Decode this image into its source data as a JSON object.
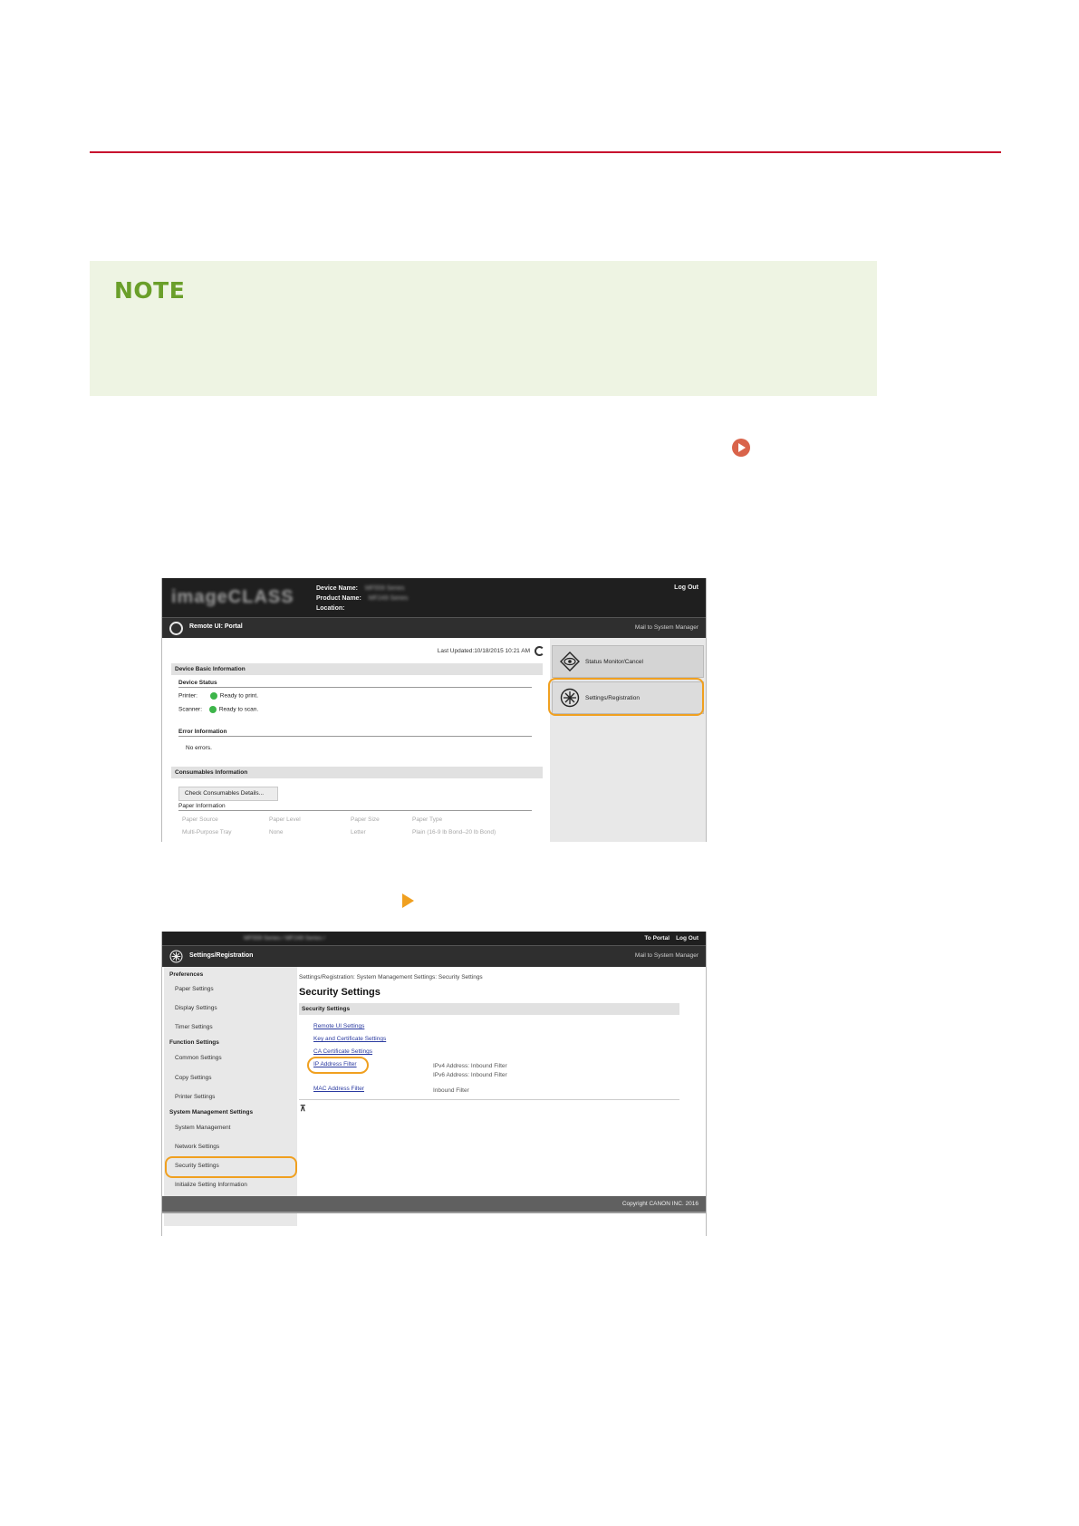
{
  "note": {
    "title": "NOTE"
  },
  "shot1": {
    "logo": "imageCLASS",
    "device_name_label": "Device Name:",
    "device_name_value": "MF559 Series",
    "product_name_label": "Product Name:",
    "product_name_value": "MF249 Series",
    "location_label": "Location:",
    "logout": "Log Out",
    "portal_title": "Remote UI: Portal",
    "mail_link": "Mail to System Manager",
    "last_updated": "Last Updated:10/18/2015 10:21 AM",
    "device_basic_info": "Device Basic Information",
    "device_status": "Device Status",
    "printer_label": "Printer:",
    "printer_status": "Ready to print.",
    "scanner_label": "Scanner:",
    "scanner_status": "Ready to scan.",
    "error_info": "Error Information",
    "no_errors": "No errors.",
    "consumables_info": "Consumables Information",
    "check_consumables": "Check Consumables Details...",
    "paper_info": "Paper Information",
    "paper_headers": [
      "Paper Source",
      "Paper Level",
      "Paper Size",
      "Paper Type"
    ],
    "paper_row": [
      "Multi-Purpose Tray",
      "None",
      "Letter",
      "Plain (16-9 lb Bond–20 lb Bond)"
    ],
    "status_monitor": "Status Monitor/Cancel",
    "settings_registration": "Settings/Registration",
    "status_color": "#3db54a"
  },
  "shot2": {
    "series": "MF559 Series / MF249 Series /",
    "to_portal": "To Portal",
    "logout": "Log Out",
    "title": "Settings/Registration",
    "mail_link": "Mail to System Manager",
    "preferences": "Preferences",
    "paper_settings": "Paper Settings",
    "display_settings": "Display Settings",
    "timer_settings": "Timer Settings",
    "function_settings": "Function Settings",
    "common_settings": "Common Settings",
    "copy_settings": "Copy Settings",
    "printer_settings": "Printer Settings",
    "system_mgmt_settings": "System Management Settings",
    "system_management": "System Management",
    "network_settings": "Network Settings",
    "security_settings_nav": "Security Settings",
    "initialize": "Initialize Setting Information",
    "breadcrumb": "Settings/Registration: System Management Settings: Security Settings",
    "page_title": "Security Settings",
    "section": "Security Settings",
    "remote_ui_settings": "Remote UI Settings",
    "key_cert_settings": "Key and Certificate Settings",
    "ca_cert_settings": "CA Certificate Settings",
    "ip_filter": "IP Address Filter",
    "ipv4_filter": "IPv4 Address: Inbound Filter",
    "ipv6_filter": "IPv6 Address: Inbound Filter",
    "mac_filter": "MAC Address Filter",
    "inbound_filter": "Inbound Filter",
    "copyright": "Copyright CANON INC. 2016"
  },
  "colors": {
    "rule": "#c8102e",
    "note_bg": "#eef4e3",
    "note_title": "#6a9f2a",
    "highlight": "#f0a020"
  }
}
